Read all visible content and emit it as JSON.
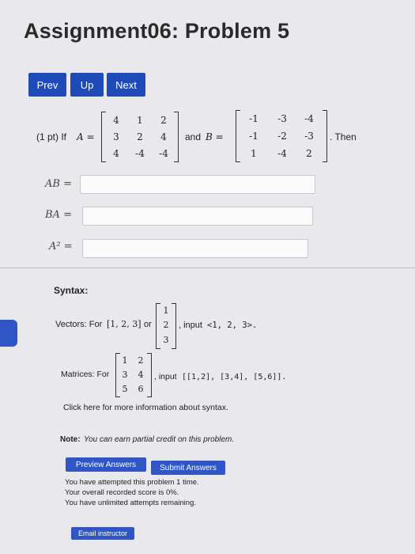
{
  "page_title": "Assignment06: Problem 5",
  "nav": {
    "prev": "Prev",
    "up": "Up",
    "next": "Next"
  },
  "problem": {
    "prefix": "(1 pt) If",
    "a_label": "A =",
    "and": "and",
    "b_label": "B =",
    "then": ". Then",
    "matrix_a": [
      [
        "4",
        "1",
        "2"
      ],
      [
        "3",
        "2",
        "4"
      ],
      [
        "4",
        "-4",
        "-4"
      ]
    ],
    "matrix_b": [
      [
        "-1",
        "-3",
        "-4"
      ],
      [
        "-1",
        "-2",
        "-3"
      ],
      [
        "1",
        "-4",
        "2"
      ]
    ]
  },
  "answers": [
    {
      "label": "AB =",
      "value": ""
    },
    {
      "label": "BA =",
      "value": ""
    },
    {
      "label": "A² =",
      "value": ""
    }
  ],
  "syntax": {
    "heading": "Syntax:",
    "vectors_prefix": "Vectors: For",
    "vector_row": "[1, 2, 3]",
    "or": "or",
    "vector_col": [
      "1",
      "2",
      "3"
    ],
    "vectors_input": ", input",
    "vectors_code": "<1, 2, 3>.",
    "matrices_prefix": "Matrices: For",
    "matrix": [
      [
        "1",
        "2"
      ],
      [
        "3",
        "4"
      ],
      [
        "5",
        "6"
      ]
    ],
    "matrices_input": ", input",
    "matrices_code": "[[1,2], [3,4], [5,6]].",
    "help_link": "Click here for more information about syntax."
  },
  "note": {
    "label": "Note:",
    "text": "You can earn partial credit on this problem."
  },
  "buttons": {
    "preview": "Preview Answers",
    "submit": "Submit Answers",
    "email": "Email instructor"
  },
  "status": [
    "You have attempted this problem 1 time.",
    "Your overall recorded score is 0%.",
    "You have unlimited attempts remaining."
  ]
}
